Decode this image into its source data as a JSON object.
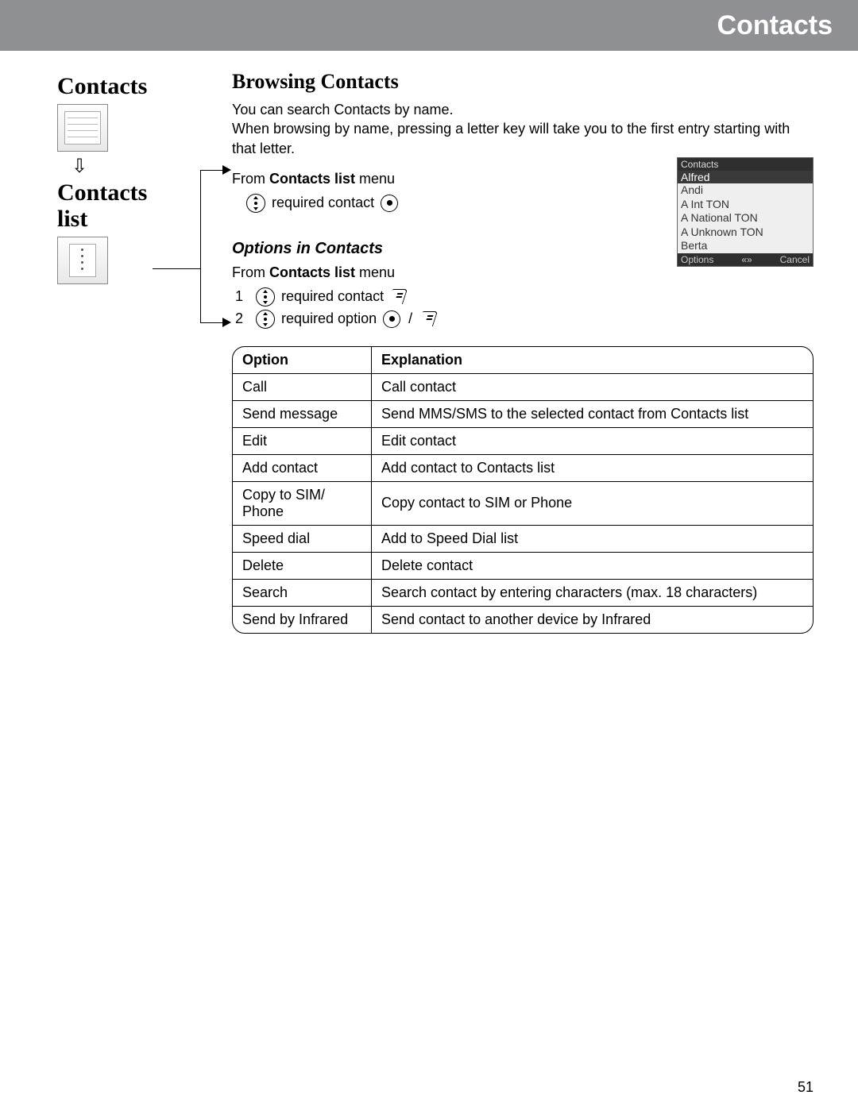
{
  "banner_title": "Contacts",
  "sidebar": {
    "title": "Contacts",
    "arrow_glyph": "⇩",
    "subtitle_line1": "Contacts",
    "subtitle_line2": "list"
  },
  "main": {
    "heading": "Browsing Contacts",
    "para1": "You can search Contacts by name.",
    "para2": "When browsing by name, pressing a letter key will take you to the first entry starting with that letter.",
    "from1_prefix": "From ",
    "from1_bold": "Contacts list",
    "from1_suffix": " menu",
    "step_required_contact": "required contact",
    "sub_heading": "Options in Contacts",
    "from2_prefix": "From ",
    "from2_bold": "Contacts list",
    "from2_suffix": " menu",
    "step1_num": "1",
    "step1_text": "required contact",
    "step2_num": "2",
    "step2_text": "required option",
    "slash": "/",
    "table_header_option": "Option",
    "table_header_explanation": "Explanation",
    "options": [
      {
        "opt": "Call",
        "exp": "Call contact"
      },
      {
        "opt": "Send message",
        "exp": "Send MMS/SMS to the selected contact from Contacts list"
      },
      {
        "opt": "Edit",
        "exp": "Edit contact"
      },
      {
        "opt": "Add contact",
        "exp": "Add contact to Contacts list"
      },
      {
        "opt": "Copy to SIM/ Phone",
        "exp": "Copy contact to SIM or Phone"
      },
      {
        "opt": "Speed dial",
        "exp": "Add to Speed Dial list"
      },
      {
        "opt": "Delete",
        "exp": "Delete contact"
      },
      {
        "opt": "Search",
        "exp": "Search contact by entering characters (max. 18 characters)"
      },
      {
        "opt": "Send by Infrared",
        "exp": "Send contact to another device by Infrared"
      }
    ]
  },
  "phone": {
    "title": "Contacts",
    "items": [
      "Alfred",
      "Andi",
      "A Int TON",
      "A National TON",
      "A Unknown TON",
      "Berta"
    ],
    "soft_left": "Options",
    "soft_mid": "«»",
    "soft_right": "Cancel"
  },
  "page_number": "51"
}
